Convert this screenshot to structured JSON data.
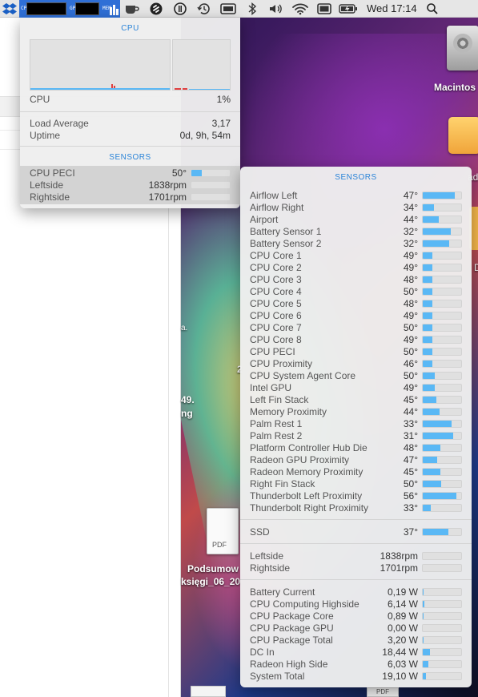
{
  "menubar": {
    "cpu_label": "CPU",
    "gpu_label": "GPU",
    "mem_label": "MEM",
    "mem_levels": [
      0.6,
      0.8,
      0.5
    ],
    "clock": "Wed 17:14"
  },
  "desktop": {
    "hd_label": "Macintos",
    "folder_label": "ad",
    "folder2_label": "D",
    "text_fragment_1": "2",
    "text_fragment_2": "49.",
    "text_fragment_3": "ng",
    "text_fragment_4": "a.",
    "pdf_label": "PDF",
    "pdf_name_1": "Podsumow",
    "pdf_name_2": "księgi_06_20",
    "pdf_bottom_label": "PDF"
  },
  "cpu_panel": {
    "title": "CPU",
    "cpu_label": "CPU",
    "cpu_value": "1%",
    "load_label": "Load Average",
    "load_value": "3,17",
    "uptime_label": "Uptime",
    "uptime_value": "0d, 9h, 54m",
    "sensors_title": "SENSORS",
    "sensors": [
      {
        "label": "CPU PECI",
        "value": "50°",
        "level": 0.28
      },
      {
        "label": "Leftside",
        "value": "1838rpm",
        "level": 0
      },
      {
        "label": "Rightside",
        "value": "1701rpm",
        "level": 0
      }
    ]
  },
  "sensors_panel": {
    "title": "SENSORS",
    "temps": [
      {
        "label": "Airflow Left",
        "value": "47°",
        "level": 0.84
      },
      {
        "label": "Airflow Right",
        "value": "34°",
        "level": 0.3
      },
      {
        "label": "Airport",
        "value": "44°",
        "level": 0.42
      },
      {
        "label": "Battery Sensor 1",
        "value": "32°",
        "level": 0.72
      },
      {
        "label": "Battery Sensor 2",
        "value": "32°",
        "level": 0.68
      },
      {
        "label": "CPU Core 1",
        "value": "49°",
        "level": 0.26
      },
      {
        "label": "CPU Core 2",
        "value": "49°",
        "level": 0.26
      },
      {
        "label": "CPU Core 3",
        "value": "48°",
        "level": 0.26
      },
      {
        "label": "CPU Core 4",
        "value": "50°",
        "level": 0.26
      },
      {
        "label": "CPU Core 5",
        "value": "48°",
        "level": 0.26
      },
      {
        "label": "CPU Core 6",
        "value": "49°",
        "level": 0.26
      },
      {
        "label": "CPU Core 7",
        "value": "50°",
        "level": 0.26
      },
      {
        "label": "CPU Core 8",
        "value": "49°",
        "level": 0.26
      },
      {
        "label": "CPU PECI",
        "value": "50°",
        "level": 0.26
      },
      {
        "label": "CPU Proximity",
        "value": "46°",
        "level": 0.26
      },
      {
        "label": "CPU System Agent Core",
        "value": "50°",
        "level": 0.32
      },
      {
        "label": "Intel GPU",
        "value": "49°",
        "level": 0.32
      },
      {
        "label": "Left Fin Stack",
        "value": "45°",
        "level": 0.36
      },
      {
        "label": "Memory Proximity",
        "value": "44°",
        "level": 0.44
      },
      {
        "label": "Palm Rest 1",
        "value": "33°",
        "level": 0.74
      },
      {
        "label": "Palm Rest 2",
        "value": "31°",
        "level": 0.8
      },
      {
        "label": "Platform Controller Hub Die",
        "value": "48°",
        "level": 0.46
      },
      {
        "label": "Radeon GPU Proximity",
        "value": "47°",
        "level": 0.38
      },
      {
        "label": "Radeon Memory Proximity",
        "value": "45°",
        "level": 0.46
      },
      {
        "label": "Right Fin Stack",
        "value": "50°",
        "level": 0.48
      },
      {
        "label": "Thunderbolt Left Proximity",
        "value": "56°",
        "level": 0.88
      },
      {
        "label": "Thunderbolt Right Proximity",
        "value": "33°",
        "level": 0.2
      }
    ],
    "ssd": [
      {
        "label": "SSD",
        "value": "37°",
        "level": 0.66
      }
    ],
    "fans": [
      {
        "label": "Leftside",
        "value": "1838rpm",
        "level": 0
      },
      {
        "label": "Rightside",
        "value": "1701rpm",
        "level": 0
      }
    ],
    "power": [
      {
        "label": "Battery Current",
        "value": "0,19 W",
        "level": 0.01
      },
      {
        "label": "CPU Computing Highside",
        "value": "6,14 W",
        "level": 0.05
      },
      {
        "label": "CPU Package Core",
        "value": "0,89 W",
        "level": 0.01
      },
      {
        "label": "CPU Package GPU",
        "value": "0,00 W",
        "level": 0
      },
      {
        "label": "CPU Package Total",
        "value": "3,20 W",
        "level": 0.02
      },
      {
        "label": "DC In",
        "value": "18,44 W",
        "level": 0.18
      },
      {
        "label": "Radeon High Side",
        "value": "6,03 W",
        "level": 0.14
      },
      {
        "label": "System Total",
        "value": "19,10 W",
        "level": 0.08
      }
    ]
  },
  "colors": {
    "accent": "#2b84d8",
    "bar_fill": "#5ab8f5",
    "graph_spike": "#e04040"
  }
}
